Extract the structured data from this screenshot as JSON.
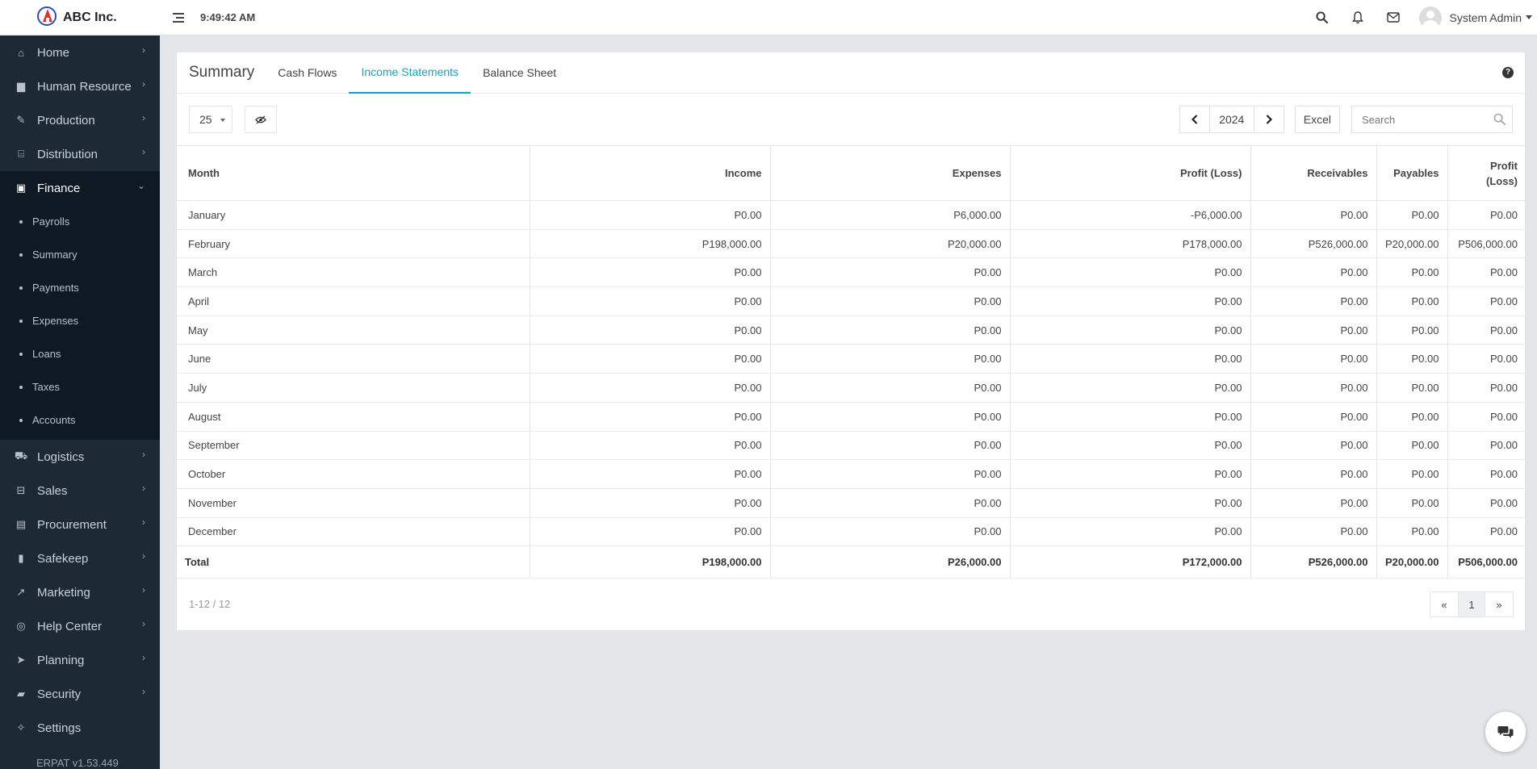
{
  "brand": {
    "name": "ABC Inc."
  },
  "header": {
    "time": "9:49:42 AM",
    "user_name": "System Admin"
  },
  "sidebar": {
    "items": [
      {
        "label": "Home",
        "icon": "home-icon"
      },
      {
        "label": "Human Resource",
        "icon": "briefcase-icon"
      },
      {
        "label": "Production",
        "icon": "gavel-icon"
      },
      {
        "label": "Distribution",
        "icon": "bank-icon"
      },
      {
        "label": "Finance",
        "icon": "money-icon"
      },
      {
        "label": "Logistics",
        "icon": "truck-icon"
      },
      {
        "label": "Sales",
        "icon": "cart-icon"
      },
      {
        "label": "Procurement",
        "icon": "building-icon"
      },
      {
        "label": "Safekeep",
        "icon": "lock-icon"
      },
      {
        "label": "Marketing",
        "icon": "chart-line-icon"
      },
      {
        "label": "Help Center",
        "icon": "lifebuoy-icon"
      },
      {
        "label": "Planning",
        "icon": "paper-plane-icon"
      },
      {
        "label": "Security",
        "icon": "padlock-icon"
      },
      {
        "label": "Settings",
        "icon": "wrench-icon"
      }
    ],
    "finance_submenu": [
      "Payrolls",
      "Summary",
      "Payments",
      "Expenses",
      "Loans",
      "Taxes",
      "Accounts"
    ],
    "version": "ERPAT v1.53.449"
  },
  "card": {
    "title": "Summary",
    "tabs": [
      "Cash Flows",
      "Income Statements",
      "Balance Sheet"
    ],
    "active_tab": "Income Statements"
  },
  "toolbar": {
    "page_size": "25",
    "year": "2024",
    "excel_label": "Excel",
    "search_placeholder": "Search"
  },
  "table": {
    "headers": [
      "Month",
      "Income",
      "Expenses",
      "Profit (Loss)",
      "Receivables",
      "Payables",
      "Profit (Loss)"
    ],
    "rows": [
      [
        "January",
        "P0.00",
        "P6,000.00",
        "-P6,000.00",
        "P0.00",
        "P0.00",
        "P0.00"
      ],
      [
        "February",
        "P198,000.00",
        "P20,000.00",
        "P178,000.00",
        "P526,000.00",
        "P20,000.00",
        "P506,000.00"
      ],
      [
        "March",
        "P0.00",
        "P0.00",
        "P0.00",
        "P0.00",
        "P0.00",
        "P0.00"
      ],
      [
        "April",
        "P0.00",
        "P0.00",
        "P0.00",
        "P0.00",
        "P0.00",
        "P0.00"
      ],
      [
        "May",
        "P0.00",
        "P0.00",
        "P0.00",
        "P0.00",
        "P0.00",
        "P0.00"
      ],
      [
        "June",
        "P0.00",
        "P0.00",
        "P0.00",
        "P0.00",
        "P0.00",
        "P0.00"
      ],
      [
        "July",
        "P0.00",
        "P0.00",
        "P0.00",
        "P0.00",
        "P0.00",
        "P0.00"
      ],
      [
        "August",
        "P0.00",
        "P0.00",
        "P0.00",
        "P0.00",
        "P0.00",
        "P0.00"
      ],
      [
        "September",
        "P0.00",
        "P0.00",
        "P0.00",
        "P0.00",
        "P0.00",
        "P0.00"
      ],
      [
        "October",
        "P0.00",
        "P0.00",
        "P0.00",
        "P0.00",
        "P0.00",
        "P0.00"
      ],
      [
        "November",
        "P0.00",
        "P0.00",
        "P0.00",
        "P0.00",
        "P0.00",
        "P0.00"
      ],
      [
        "December",
        "P0.00",
        "P0.00",
        "P0.00",
        "P0.00",
        "P0.00",
        "P0.00"
      ]
    ],
    "total": [
      "Total",
      "P198,000.00",
      "P26,000.00",
      "P172,000.00",
      "P526,000.00",
      "P20,000.00",
      "P506,000.00"
    ]
  },
  "pagination": {
    "summary": "1-12 / 12",
    "prev": "«",
    "current": "1",
    "next": "»"
  },
  "colors": {
    "accent": "#17a2b8",
    "sidebar_bg": "#1d2935",
    "sidebar_active_bg": "#0f1923"
  }
}
